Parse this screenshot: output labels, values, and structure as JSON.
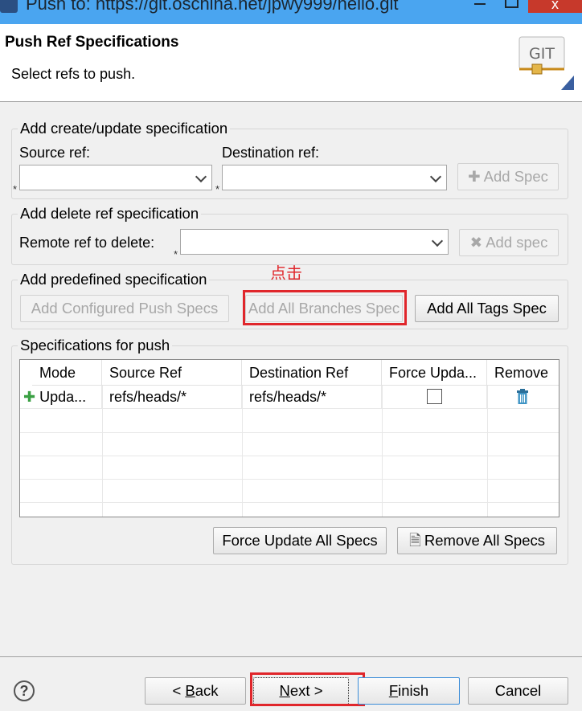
{
  "window": {
    "title": "Push to: https://git.oschina.net/jpwy999/hello.git",
    "close_label": "x"
  },
  "header": {
    "title": "Push Ref Specifications",
    "subtitle": "Select refs to push.",
    "logo_text": "GIT"
  },
  "create_group": {
    "legend": "Add create/update specification",
    "source_label": "Source ref:",
    "destination_label": "Destination ref:",
    "source_value": "",
    "destination_value": "",
    "add_spec_label": "Add Spec"
  },
  "delete_group": {
    "legend": "Add delete ref specification",
    "remote_label": "Remote ref to delete:",
    "remote_value": "",
    "add_spec_label": "Add spec"
  },
  "annotation": "点击",
  "predefined_group": {
    "legend": "Add predefined specification",
    "configured_label": "Add Configured Push Specs",
    "branches_label": "Add All Branches Spec",
    "tags_label": "Add All Tags Spec"
  },
  "specs_group": {
    "legend": "Specifications for push",
    "columns": [
      "Mode",
      "Source Ref",
      "Destination Ref",
      "Force Upda...",
      "Remove"
    ],
    "rows": [
      {
        "mode": "Upda...",
        "source": "refs/heads/*",
        "destination": "refs/heads/*",
        "force": false
      }
    ],
    "force_all_label": "Force Update All Specs",
    "remove_all_label": "Remove All Specs"
  },
  "footer": {
    "help_label": "?",
    "back_prefix": "< ",
    "back_mnemonic": "B",
    "back_rest": "ack",
    "next_mnemonic": "N",
    "next_rest": "ext >",
    "finish_mnemonic": "F",
    "finish_rest": "inish",
    "cancel_label": "Cancel"
  },
  "colors": {
    "annotation": "#e0262b",
    "titlebar": "#4aa5f0",
    "close": "#c7392b"
  }
}
